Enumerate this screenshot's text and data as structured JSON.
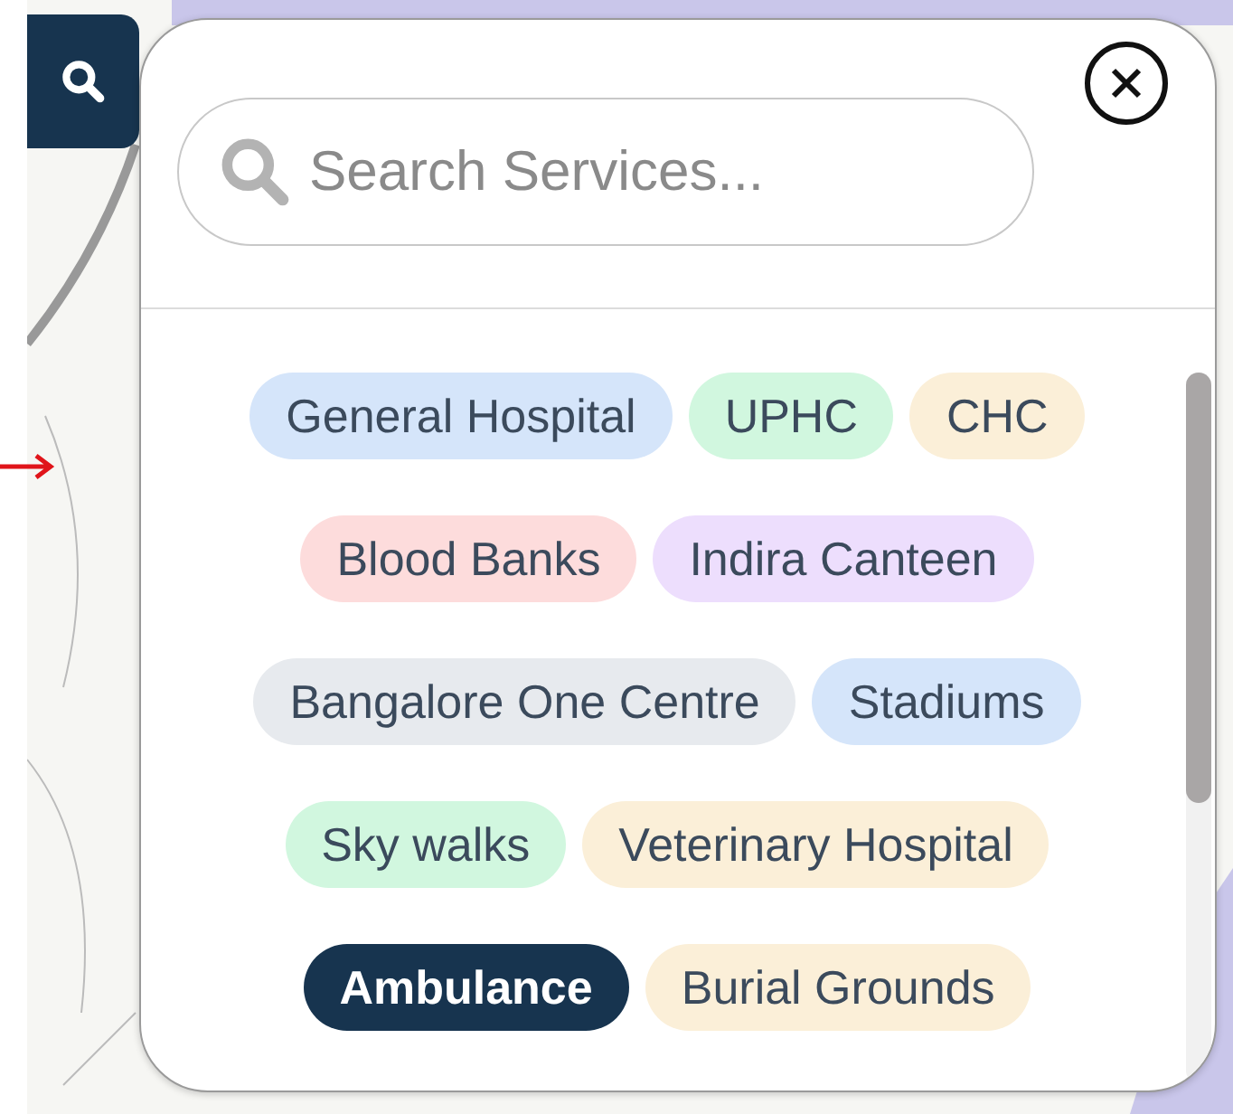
{
  "search_panel": {
    "search_field": {
      "placeholder": "Search Services..."
    },
    "services": [
      {
        "label": "General Hospital",
        "color": "#d5e5fa",
        "selected": false
      },
      {
        "label": "UPHC",
        "color": "#d1f7df",
        "selected": false
      },
      {
        "label": "CHC",
        "color": "#fbefd8",
        "selected": false
      },
      {
        "label": "Blood Banks",
        "color": "#fddcdc",
        "selected": false
      },
      {
        "label": "Indira Canteen",
        "color": "#eddefd",
        "selected": false
      },
      {
        "label": "Bangalore One Centre",
        "color": "#e7eaee",
        "selected": false
      },
      {
        "label": "Stadiums",
        "color": "#d5e5fa",
        "selected": false
      },
      {
        "label": "Sky walks",
        "color": "#d1f7df",
        "selected": false
      },
      {
        "label": "Veterinary Hospital",
        "color": "#fbefd8",
        "selected": false
      },
      {
        "label": "Ambulance",
        "color": "#17344f",
        "selected": true
      },
      {
        "label": "Burial Grounds",
        "color": "#fbefd8",
        "selected": false
      }
    ]
  }
}
